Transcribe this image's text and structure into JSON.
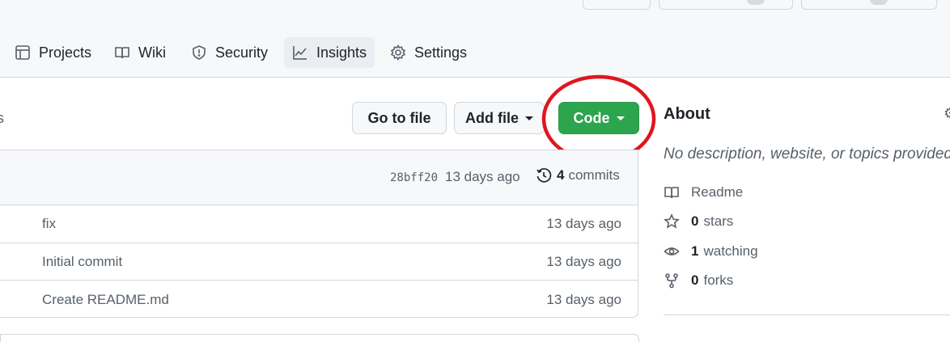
{
  "nav": {
    "tabs": [
      {
        "label": "Projects",
        "icon": "projects-icon"
      },
      {
        "label": "Wiki",
        "icon": "book-icon"
      },
      {
        "label": "Security",
        "icon": "shield-icon"
      },
      {
        "label": "Insights",
        "icon": "graph-icon",
        "active": true
      },
      {
        "label": "Settings",
        "icon": "gear-icon"
      }
    ]
  },
  "toolbar": {
    "left_fragment": "s",
    "go_to_file": "Go to file",
    "add_file": "Add file",
    "code": "Code"
  },
  "commit": {
    "sha": "28bff20",
    "age": "13 days ago",
    "count": "4",
    "count_label": "commits"
  },
  "files": [
    {
      "message": "fix",
      "age": "13 days ago"
    },
    {
      "message": "Initial commit",
      "age": "13 days ago"
    },
    {
      "message": "Create README.md",
      "age": "13 days ago"
    }
  ],
  "about": {
    "title": "About",
    "description": "No description, website, or topics provided",
    "readme": "Readme",
    "stars_count": "0",
    "stars_label": "stars",
    "watching_count": "1",
    "watching_label": "watching",
    "forks_count": "0",
    "forks_label": "forks"
  },
  "colors": {
    "accent_green": "#2da44e",
    "annotation_red": "#e0161e"
  }
}
